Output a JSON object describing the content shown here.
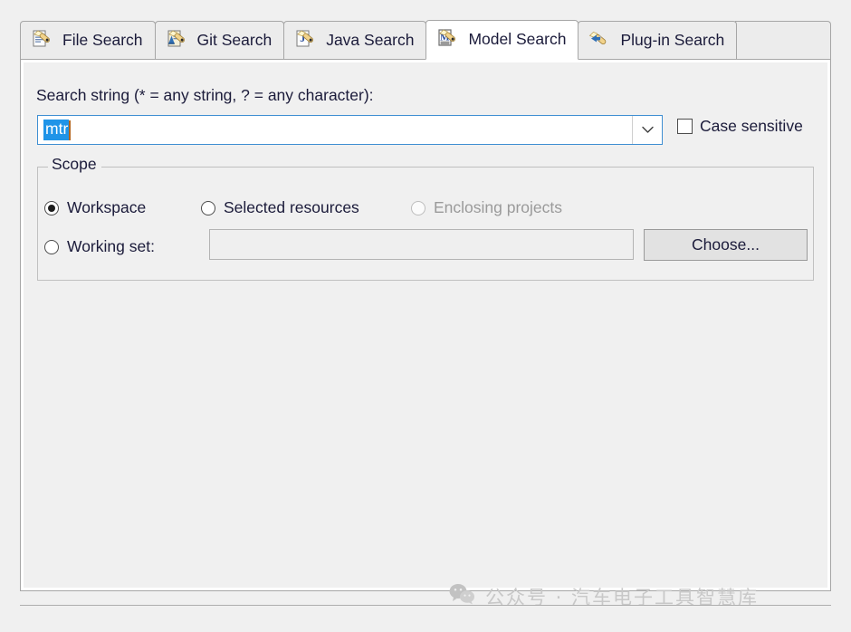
{
  "dialog": {
    "tabs": [
      {
        "label": "File Search",
        "icon": "file-search-icon",
        "selected": false
      },
      {
        "label": "Git Search",
        "icon": "git-search-icon",
        "selected": false
      },
      {
        "label": "Java Search",
        "icon": "java-search-icon",
        "selected": false
      },
      {
        "label": "Model Search",
        "icon": "model-search-icon",
        "selected": true
      },
      {
        "label": "Plug-in Search",
        "icon": "plugin-search-icon",
        "selected": false
      }
    ],
    "search": {
      "label": "Search string (* = any string, ? = any character):",
      "value": "mtr",
      "placeholder": "",
      "selected_text": "mtr",
      "dropdown_icon": "chevron-down-icon",
      "selection_color": "#1f94e8",
      "caret_color": "#b5651d",
      "focus_border_color": "#3f8fd2"
    },
    "case_sensitive": {
      "label": "Case sensitive",
      "checked": false
    },
    "scope": {
      "legend": "Scope",
      "options": [
        {
          "label": "Workspace",
          "checked": true,
          "disabled": false
        },
        {
          "label": "Selected resources",
          "checked": false,
          "disabled": false
        },
        {
          "label": "Enclosing projects",
          "checked": false,
          "disabled": true
        },
        {
          "label": "Working set:",
          "checked": false,
          "disabled": false
        }
      ],
      "working_set_value": "",
      "choose_label": "Choose..."
    }
  },
  "watermark": {
    "icon": "wechat-logo-icon",
    "text": "公众号 · 汽车电子工具智慧库",
    "color": "#c8c8c8"
  }
}
